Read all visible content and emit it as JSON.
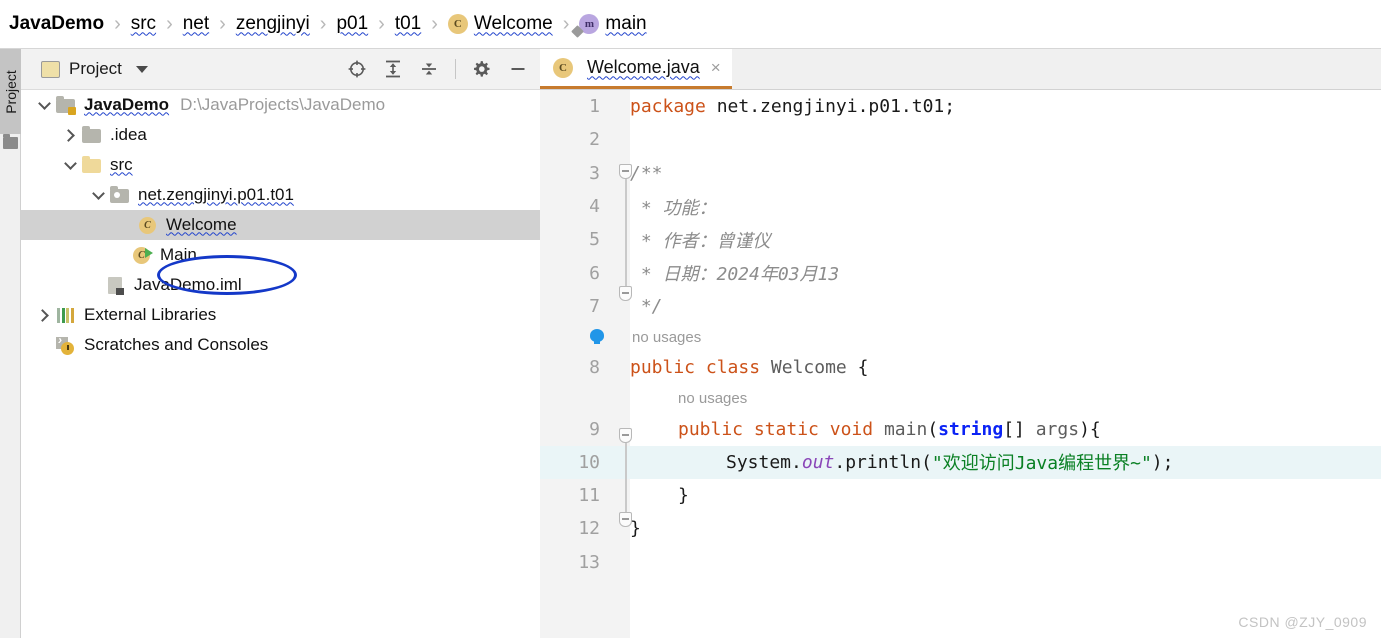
{
  "breadcrumb": {
    "items": [
      {
        "label": "JavaDemo",
        "style": "bold",
        "icon": "none"
      },
      {
        "label": "src",
        "style": "wavy",
        "icon": "none"
      },
      {
        "label": "net",
        "style": "wavy",
        "icon": "none"
      },
      {
        "label": "zengjinyi",
        "style": "wavy",
        "icon": "none"
      },
      {
        "label": "p01",
        "style": "wavy",
        "icon": "none"
      },
      {
        "label": "t01",
        "style": "wavy",
        "icon": "none"
      },
      {
        "label": "Welcome",
        "style": "wavy",
        "icon": "class-icon",
        "icon_letter": "C"
      },
      {
        "label": "main",
        "style": "wavy",
        "icon": "method-icon",
        "icon_letter": "m"
      }
    ],
    "separator": "›"
  },
  "tool_strip": {
    "tab_label": "Project",
    "folder_icon": "folder-icon"
  },
  "project_toolbar": {
    "title": "Project",
    "folder_icon": "project-folder-icon",
    "dropdown_caret": "chevron-down-icon",
    "icons": [
      {
        "name": "select-opened-file-icon",
        "title": "Select Opened File"
      },
      {
        "name": "expand-all-icon",
        "title": "Expand All"
      },
      {
        "name": "collapse-all-icon",
        "title": "Collapse All"
      },
      {
        "name": "settings-gear-icon",
        "title": "Settings"
      },
      {
        "name": "hide-panel-icon",
        "title": "Hide"
      }
    ]
  },
  "tree": {
    "nodes": [
      {
        "label": "JavaDemo",
        "path": "D:\\JavaProjects\\JavaDemo",
        "icon": "module-folder-icon",
        "twisty": "down",
        "indent": 0,
        "bold": true,
        "wavy": true,
        "selected": false
      },
      {
        "label": ".idea",
        "path": "",
        "icon": "folder-icon",
        "twisty": "right",
        "indent": 1,
        "bold": false,
        "wavy": false,
        "selected": false
      },
      {
        "label": "src",
        "path": "",
        "icon": "source-folder-icon",
        "twisty": "down",
        "indent": 1,
        "bold": false,
        "wavy": true,
        "selected": false
      },
      {
        "label": "net.zengjinyi.p01.t01",
        "path": "",
        "icon": "package-icon",
        "twisty": "down",
        "indent": 2,
        "bold": false,
        "wavy": true,
        "selected": false
      },
      {
        "label": "Welcome",
        "path": "",
        "icon": "class-icon",
        "twisty": "none",
        "indent": 3,
        "bold": false,
        "wavy": true,
        "selected": true
      },
      {
        "label": "Main",
        "path": "",
        "icon": "runnable-class-icon",
        "twisty": "none",
        "indent": 3,
        "bold": false,
        "wavy": false,
        "selected": false
      },
      {
        "label": "JavaDemo.iml",
        "path": "",
        "icon": "iml-file-icon",
        "twisty": "none",
        "indent": 2,
        "bold": false,
        "wavy": false,
        "selected": false
      },
      {
        "label": "External Libraries",
        "path": "",
        "icon": "libraries-icon",
        "twisty": "right",
        "indent": 0,
        "bold": false,
        "wavy": false,
        "selected": false
      },
      {
        "label": "Scratches and Consoles",
        "path": "",
        "icon": "scratches-icon",
        "twisty": "none",
        "indent": 0,
        "bold": false,
        "wavy": false,
        "selected": false
      }
    ]
  },
  "annotation": {
    "shape": "ellipse",
    "color": "#1438c8",
    "target": "Welcome"
  },
  "editor": {
    "tab": {
      "label": "Welcome.java",
      "icon": "class-icon",
      "icon_letter": "C",
      "close": "×"
    },
    "lines": [
      {
        "num": "1",
        "current": false,
        "fold": "none",
        "bulb": false
      },
      {
        "num": "2",
        "current": false,
        "fold": "none",
        "bulb": false
      },
      {
        "num": "3",
        "current": false,
        "fold": "start",
        "bulb": false
      },
      {
        "num": "4",
        "current": false,
        "fold": "mid",
        "bulb": false
      },
      {
        "num": "5",
        "current": false,
        "fold": "mid",
        "bulb": false
      },
      {
        "num": "6",
        "current": false,
        "fold": "mid",
        "bulb": false
      },
      {
        "num": "7",
        "current": false,
        "fold": "end",
        "bulb": false
      },
      {
        "num": "8",
        "current": false,
        "fold": "none",
        "bulb": false
      },
      {
        "num": "9",
        "current": false,
        "fold": "start",
        "bulb": false
      },
      {
        "num": "10",
        "current": true,
        "fold": "mid",
        "bulb": true
      },
      {
        "num": "11",
        "current": false,
        "fold": "end",
        "bulb": false
      },
      {
        "num": "12",
        "current": false,
        "fold": "none",
        "bulb": false
      },
      {
        "num": "13",
        "current": false,
        "fold": "none",
        "bulb": false
      }
    ],
    "code": {
      "l1_kw": "package",
      "l1_rest": " net.zengjinyi.p01.t01;",
      "l3": "/**",
      "l4": " * 功能：",
      "l5": " * 作者：曾谨仪",
      "l6": " * 日期：2024年03月13",
      "l7": " */",
      "hint_class": "no usages",
      "hint_method": "no usages",
      "l8_kw1": "public",
      "l8_kw2": "class",
      "l8_name": "Welcome",
      "l8_brace": "{",
      "l9_kw1": "public",
      "l9_kw2": "static",
      "l9_kw3": "void",
      "l9_name": "main",
      "l9_paren": "(",
      "l9_type": "string",
      "l9_arr": "[] ",
      "l9_arg": "args",
      "l9_tail": "){",
      "l10_sys": "System.",
      "l10_out": "out",
      "l10_println": ".println(",
      "l10_str": "\"欢迎访问Java编程世界~\"",
      "l10_tail": ");",
      "l11": "}",
      "l12": "}"
    }
  },
  "watermark": "CSDN @ZJY_0909"
}
